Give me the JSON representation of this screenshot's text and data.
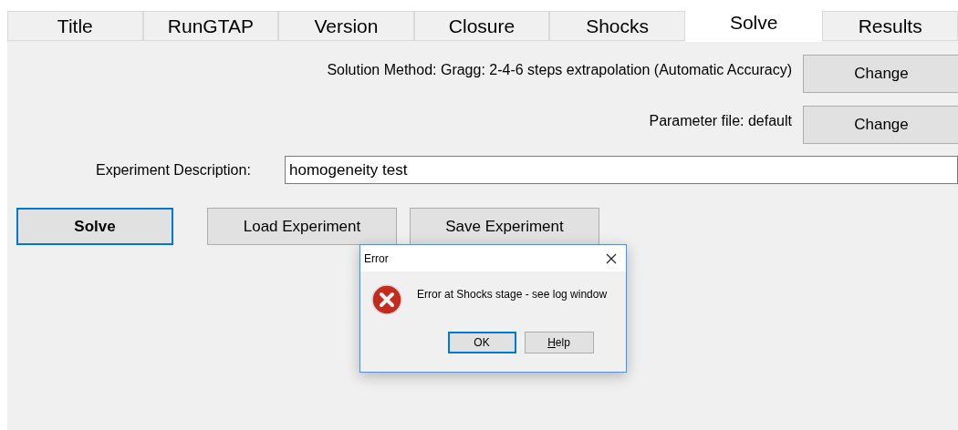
{
  "tabs": [
    {
      "label": "Title",
      "selected": false
    },
    {
      "label": "RunGTAP",
      "selected": false
    },
    {
      "label": "Version",
      "selected": false
    },
    {
      "label": "Closure",
      "selected": false
    },
    {
      "label": "Shocks",
      "selected": false
    },
    {
      "label": "Solve",
      "selected": true
    },
    {
      "label": "Results",
      "selected": false
    }
  ],
  "settings": [
    {
      "label": "Solution Method: Gragg: 2-4-6 steps extrapolation (Automatic Accuracy)",
      "button": "Change"
    },
    {
      "label": "Parameter file: default",
      "button": "Change"
    }
  ],
  "experiment": {
    "label": "Experiment Description:",
    "value": "homogeneity test"
  },
  "actions": [
    {
      "label": "Solve",
      "focused": true
    },
    {
      "label": "Load Experiment",
      "focused": false
    },
    {
      "label": "Save Experiment",
      "focused": false
    }
  ],
  "dialog": {
    "title": "Error",
    "message": "Error at Shocks stage - see log window",
    "buttons": [
      {
        "label": "OK",
        "focused": true
      },
      {
        "label": "Help",
        "focused": false
      }
    ]
  }
}
